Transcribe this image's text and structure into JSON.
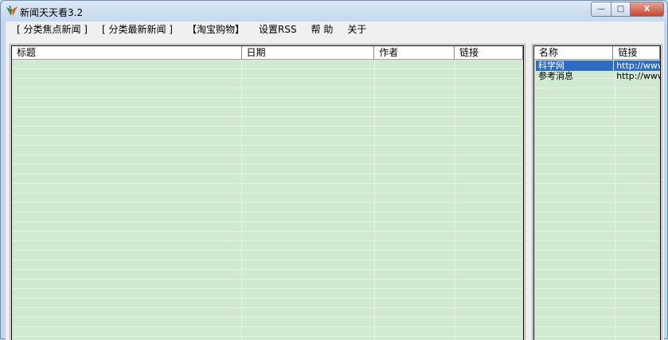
{
  "window": {
    "title": "新闻天天看3.2",
    "minimize": "—",
    "maximize": "□",
    "close": "X"
  },
  "menu": [
    "[ 分类焦点新闻 ]",
    "[ 分类最新新闻 ]",
    "【淘宝购物】",
    "设置RSS",
    "帮 助",
    "关于"
  ],
  "news_list": {
    "columns": [
      "标题",
      "日期",
      "作者",
      "链接"
    ],
    "rows": []
  },
  "source_list": {
    "columns": [
      "名称",
      "链接"
    ],
    "rows": [
      {
        "name": "科学网",
        "link": "http://www",
        "selected": true
      },
      {
        "name": "参考消息",
        "link": "http://www",
        "selected": false
      }
    ]
  }
}
